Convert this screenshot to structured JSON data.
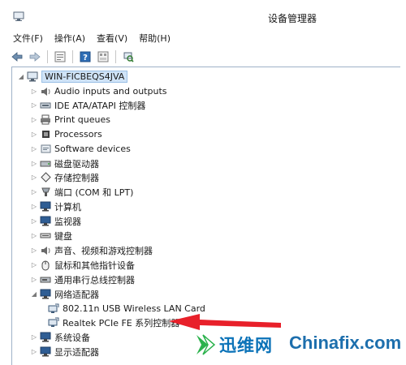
{
  "window": {
    "title": "设备管理器"
  },
  "menu": [
    {
      "label": "文件(F)"
    },
    {
      "label": "操作(A)"
    },
    {
      "label": "查看(V)"
    },
    {
      "label": "帮助(H)"
    }
  ],
  "toolbar": {
    "buttons": [
      {
        "icon": "back-arrow-icon"
      },
      {
        "icon": "forward-arrow-icon"
      },
      {
        "icon": "properties-icon"
      },
      {
        "icon": "help-icon"
      },
      {
        "icon": "show-hidden-icon"
      },
      {
        "icon": "scan-hardware-icon"
      }
    ]
  },
  "tree": {
    "root": {
      "label": "WIN-FICBEQS4JVA",
      "expanded": true
    },
    "items": [
      {
        "label": "Audio inputs and outputs",
        "icon": "speaker-icon",
        "level": 1,
        "expander": "collapsed"
      },
      {
        "label": "IDE ATA/ATAPI 控制器",
        "icon": "ide-controller-icon",
        "level": 1,
        "expander": "collapsed"
      },
      {
        "label": "Print queues",
        "icon": "printer-icon",
        "level": 1,
        "expander": "collapsed"
      },
      {
        "label": "Processors",
        "icon": "processor-icon",
        "level": 1,
        "expander": "collapsed"
      },
      {
        "label": "Software devices",
        "icon": "software-device-icon",
        "level": 1,
        "expander": "collapsed"
      },
      {
        "label": "磁盘驱动器",
        "icon": "disk-drive-icon",
        "level": 1,
        "expander": "collapsed"
      },
      {
        "label": "存储控制器",
        "icon": "storage-controller-icon",
        "level": 1,
        "expander": "collapsed"
      },
      {
        "label": "端口 (COM 和 LPT)",
        "icon": "port-icon",
        "level": 1,
        "expander": "collapsed"
      },
      {
        "label": "计算机",
        "icon": "computer-icon",
        "level": 1,
        "expander": "collapsed"
      },
      {
        "label": "监视器",
        "icon": "monitor-icon",
        "level": 1,
        "expander": "collapsed"
      },
      {
        "label": "键盘",
        "icon": "keyboard-icon",
        "level": 1,
        "expander": "collapsed"
      },
      {
        "label": "声音、视频和游戏控制器",
        "icon": "sound-video-icon",
        "level": 1,
        "expander": "collapsed"
      },
      {
        "label": "鼠标和其他指针设备",
        "icon": "mouse-icon",
        "level": 1,
        "expander": "collapsed"
      },
      {
        "label": "通用串行总线控制器",
        "icon": "usb-controller-icon",
        "level": 1,
        "expander": "collapsed"
      },
      {
        "label": "网络适配器",
        "icon": "network-adapter-icon",
        "level": 1,
        "expander": "expanded"
      },
      {
        "label": "802.11n USB Wireless LAN Card",
        "icon": "network-card-icon",
        "level": 2,
        "expander": "none"
      },
      {
        "label": "Realtek PCIe FE 系列控制器",
        "icon": "network-card-icon",
        "level": 2,
        "expander": "none"
      },
      {
        "label": "系统设备",
        "icon": "system-device-icon",
        "level": 1,
        "expander": "collapsed"
      },
      {
        "label": "显示适配器",
        "icon": "display-adapter-icon",
        "level": 1,
        "expander": "collapsed"
      }
    ]
  },
  "annotation": {
    "arrow_color": "#e8202a",
    "points_to": "Realtek PCIe FE 系列控制器"
  },
  "watermark": {
    "brand": "迅维网",
    "site": "Chinafix.com",
    "brand_color": "#0a72b8"
  }
}
